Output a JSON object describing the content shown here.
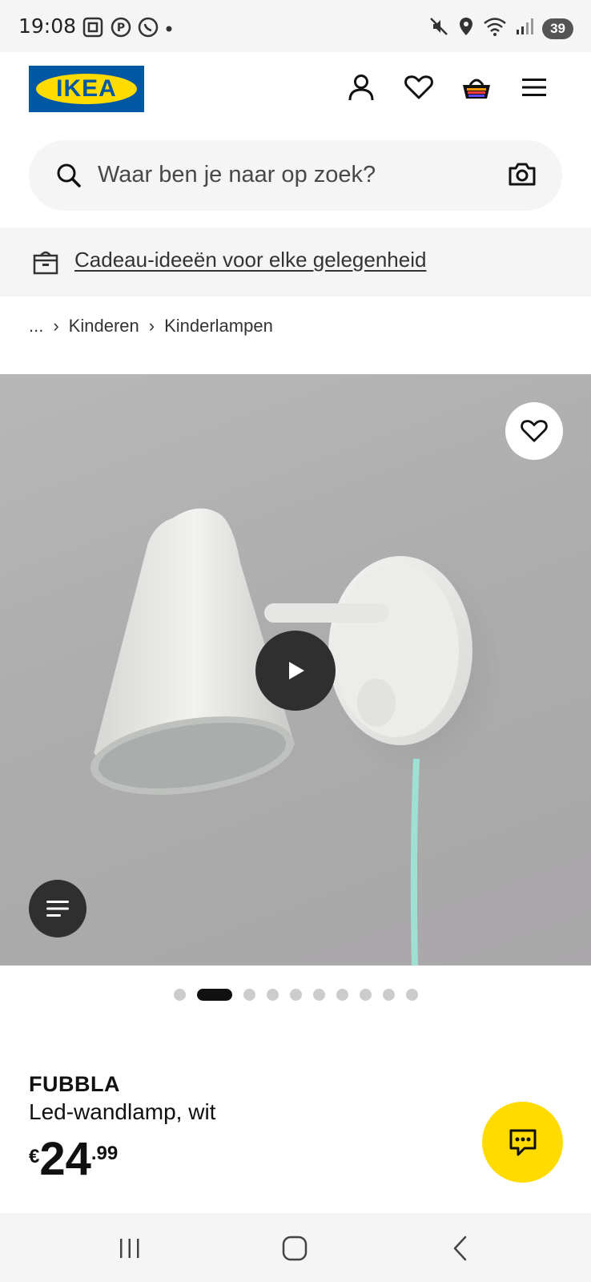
{
  "status_bar": {
    "time": "19:08",
    "battery": "39",
    "left_icons": [
      "screenshot-icon",
      "pinterest-icon",
      "whatsapp-icon",
      "dot-icon"
    ],
    "right_icons": [
      "mute-icon",
      "location-icon",
      "wifi-icon",
      "signal-icon",
      "battery-icon"
    ]
  },
  "header": {
    "logo_text": "IKEA",
    "icons": [
      "account-icon",
      "wishlist-icon",
      "cart-icon",
      "menu-icon"
    ]
  },
  "search": {
    "placeholder": "Waar ben je naar op zoek?"
  },
  "banner": {
    "link_text": "Cadeau-ideeën voor elke gelegenheid"
  },
  "breadcrumb": {
    "items": [
      "...",
      "Kinderen",
      "Kinderlampen"
    ]
  },
  "gallery": {
    "total_dots": 10,
    "active_index": 1
  },
  "product": {
    "name": "FUBBLA",
    "description": "Led-wandlamp, wit",
    "currency": "€",
    "price_int": "24",
    "price_dec": ".99"
  },
  "colors": {
    "ikea_blue": "#0058a3",
    "ikea_yellow": "#ffdb00",
    "cord": "#9fe0d4"
  }
}
